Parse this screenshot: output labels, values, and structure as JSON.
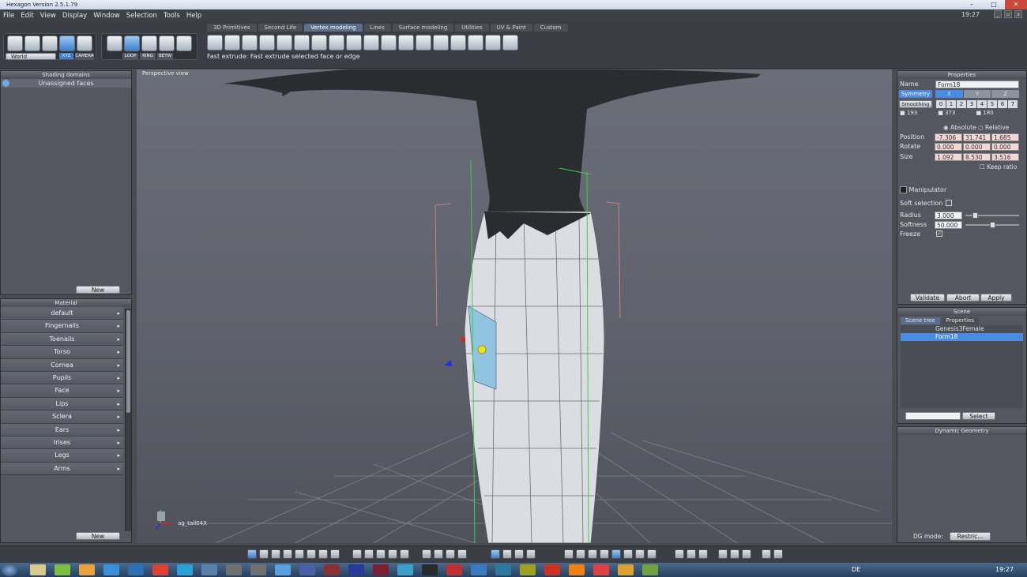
{
  "window": {
    "title": "Hexagon Version 2.5.1.79",
    "clock_top": "19:27"
  },
  "menu": [
    "File",
    "Edit",
    "View",
    "Display",
    "Window",
    "Selection",
    "Tools",
    "Help"
  ],
  "toolbar": {
    "space": "World",
    "xyz": "XYZ",
    "camera": "CAMERA",
    "loop": "LOOP",
    "ring": "RING",
    "betw": "BETW"
  },
  "tabs": [
    {
      "label": "3D Primitives",
      "active": false
    },
    {
      "label": "Second Life",
      "active": false
    },
    {
      "label": "Vertex modeling",
      "active": true
    },
    {
      "label": "Lines",
      "active": false
    },
    {
      "label": "Surface modeling",
      "active": false
    },
    {
      "label": "Utilities",
      "active": false
    },
    {
      "label": "UV & Paint",
      "active": false
    },
    {
      "label": "Custom",
      "active": false
    }
  ],
  "hint": "Fast extrude: Fast extrude selected face or edge",
  "shading": {
    "title": "Shading domains",
    "item": "Unassigned faces",
    "new": "New"
  },
  "material": {
    "title": "Material",
    "items": [
      "default",
      "Fingernails",
      "Toenails",
      "Torso",
      "Cornea",
      "Pupils",
      "Face",
      "Lips",
      "Sclera",
      "Ears",
      "Irises",
      "Legs",
      "Arms"
    ],
    "new": "New"
  },
  "viewport": {
    "label": "Perspective view",
    "axis_label": "ag_tail04X"
  },
  "properties": {
    "title": "Properties",
    "name_label": "Name",
    "name_value": "Form18",
    "symmetry": "Symmetry",
    "axes": [
      "X",
      "Y",
      "Z"
    ],
    "smoothing": "Smoothing",
    "levels": [
      "0",
      "1",
      "2",
      "3",
      "4",
      "5",
      "6",
      "7"
    ],
    "counts": [
      "193",
      "373",
      "180"
    ],
    "absolute": "Absolute",
    "relative": "Relative",
    "position_label": "Position",
    "position": [
      "-7.306",
      "31.741",
      "1.685"
    ],
    "rotate_label": "Rotate",
    "rotate": [
      "0.000",
      "0.000",
      "0.000"
    ],
    "size_label": "Size",
    "size": [
      "1.092",
      "8.530",
      "3.516"
    ],
    "keep_ratio": "Keep ratio",
    "manipulator": "Manipulator",
    "soft_selection": "Soft selection",
    "radius_label": "Radius",
    "radius": "3.000",
    "radius_level": 0.15,
    "softness_label": "Softness",
    "softness": "50.000",
    "softness_level": 0.5,
    "freeze": "Freeze",
    "validate": "Validate",
    "abort": "Abort",
    "apply": "Apply"
  },
  "scene": {
    "title": "Scene",
    "tab_tree": "Scene tree",
    "tab_props": "Properties",
    "items": [
      "Genesis3Female",
      "Form18"
    ],
    "select": "Select"
  },
  "dynamic": {
    "title": "Dynamic Geometry",
    "dg_label": "DG mode:",
    "dg_value": "Restric..."
  },
  "taskbar": {
    "lang": "DE",
    "time": "19:27"
  },
  "colors": {
    "accent": "#4a8ae0",
    "selected_face": "#8fc3df",
    "mesh": "#dcdde3",
    "body": "#2b2c30"
  }
}
